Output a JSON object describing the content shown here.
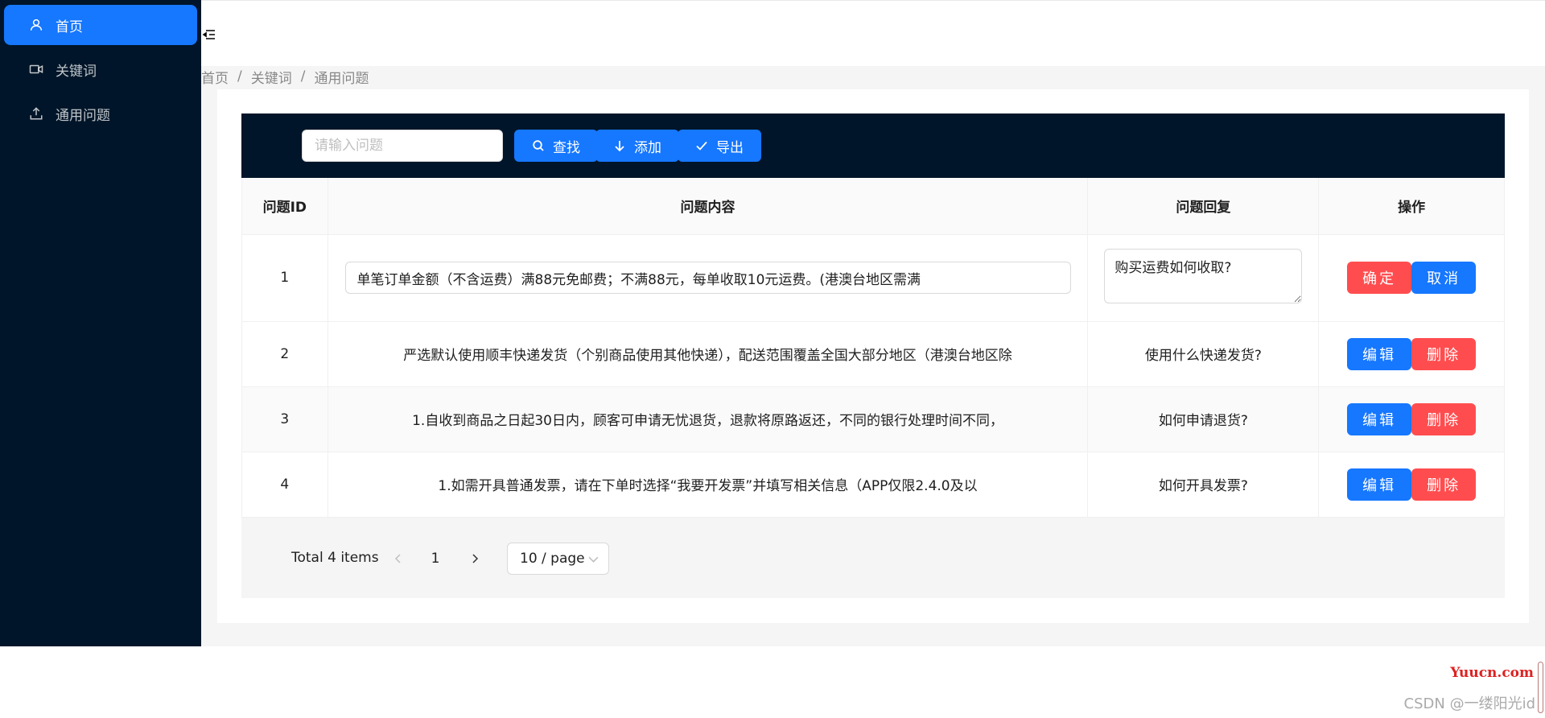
{
  "sidebar": {
    "items": [
      {
        "label": "首页",
        "icon": "user-icon",
        "active": true
      },
      {
        "label": "关键词",
        "icon": "video-camera-icon",
        "active": false
      },
      {
        "label": "通用问题",
        "icon": "upload-icon",
        "active": false
      }
    ]
  },
  "breadcrumb": [
    "首页",
    "关键词",
    "通用问题"
  ],
  "toolbar": {
    "search_placeholder": "请输入问题",
    "search_label": "查找",
    "add_label": "添加",
    "export_label": "导出"
  },
  "table": {
    "headers": [
      "问题ID",
      "问题内容",
      "问题回复",
      "操作"
    ],
    "rows": [
      {
        "id": "1",
        "content": "单笔订单金额（不含运费）满88元免邮费；不满88元，每单收取10元运费。(港澳台地区需满",
        "reply": "购买运费如何收取?",
        "editing": true,
        "btn1": "确定",
        "btn2": "取消"
      },
      {
        "id": "2",
        "content": "严选默认使用顺丰快递发货（个别商品使用其他快递），配送范围覆盖全国大部分地区（港澳台地区除",
        "reply": "使用什么快递发货?",
        "editing": false,
        "btn1": "编辑",
        "btn2": "删除"
      },
      {
        "id": "3",
        "content": "1.自收到商品之日起30日内，顾客可申请无忧退货，退款将原路返还，不同的银行处理时间不同，",
        "reply": "如何申请退货?",
        "editing": false,
        "btn1": "编辑",
        "btn2": "删除"
      },
      {
        "id": "4",
        "content": "1.如需开具普通发票，请在下单时选择“我要开发票”并填写相关信息（APP仅限2.4.0及以",
        "reply": "如何开具发票?",
        "editing": false,
        "btn1": "编辑",
        "btn2": "删除"
      }
    ]
  },
  "pagination": {
    "total_text": "Total 4 items",
    "current_page": "1",
    "page_size": "10 / page"
  },
  "watermark": {
    "site": "Yuucn.com",
    "author": "CSDN @一缕阳光id"
  },
  "colors": {
    "primary": "#1677ff",
    "danger": "#ff4d4f",
    "sidebar_bg": "#001529"
  }
}
